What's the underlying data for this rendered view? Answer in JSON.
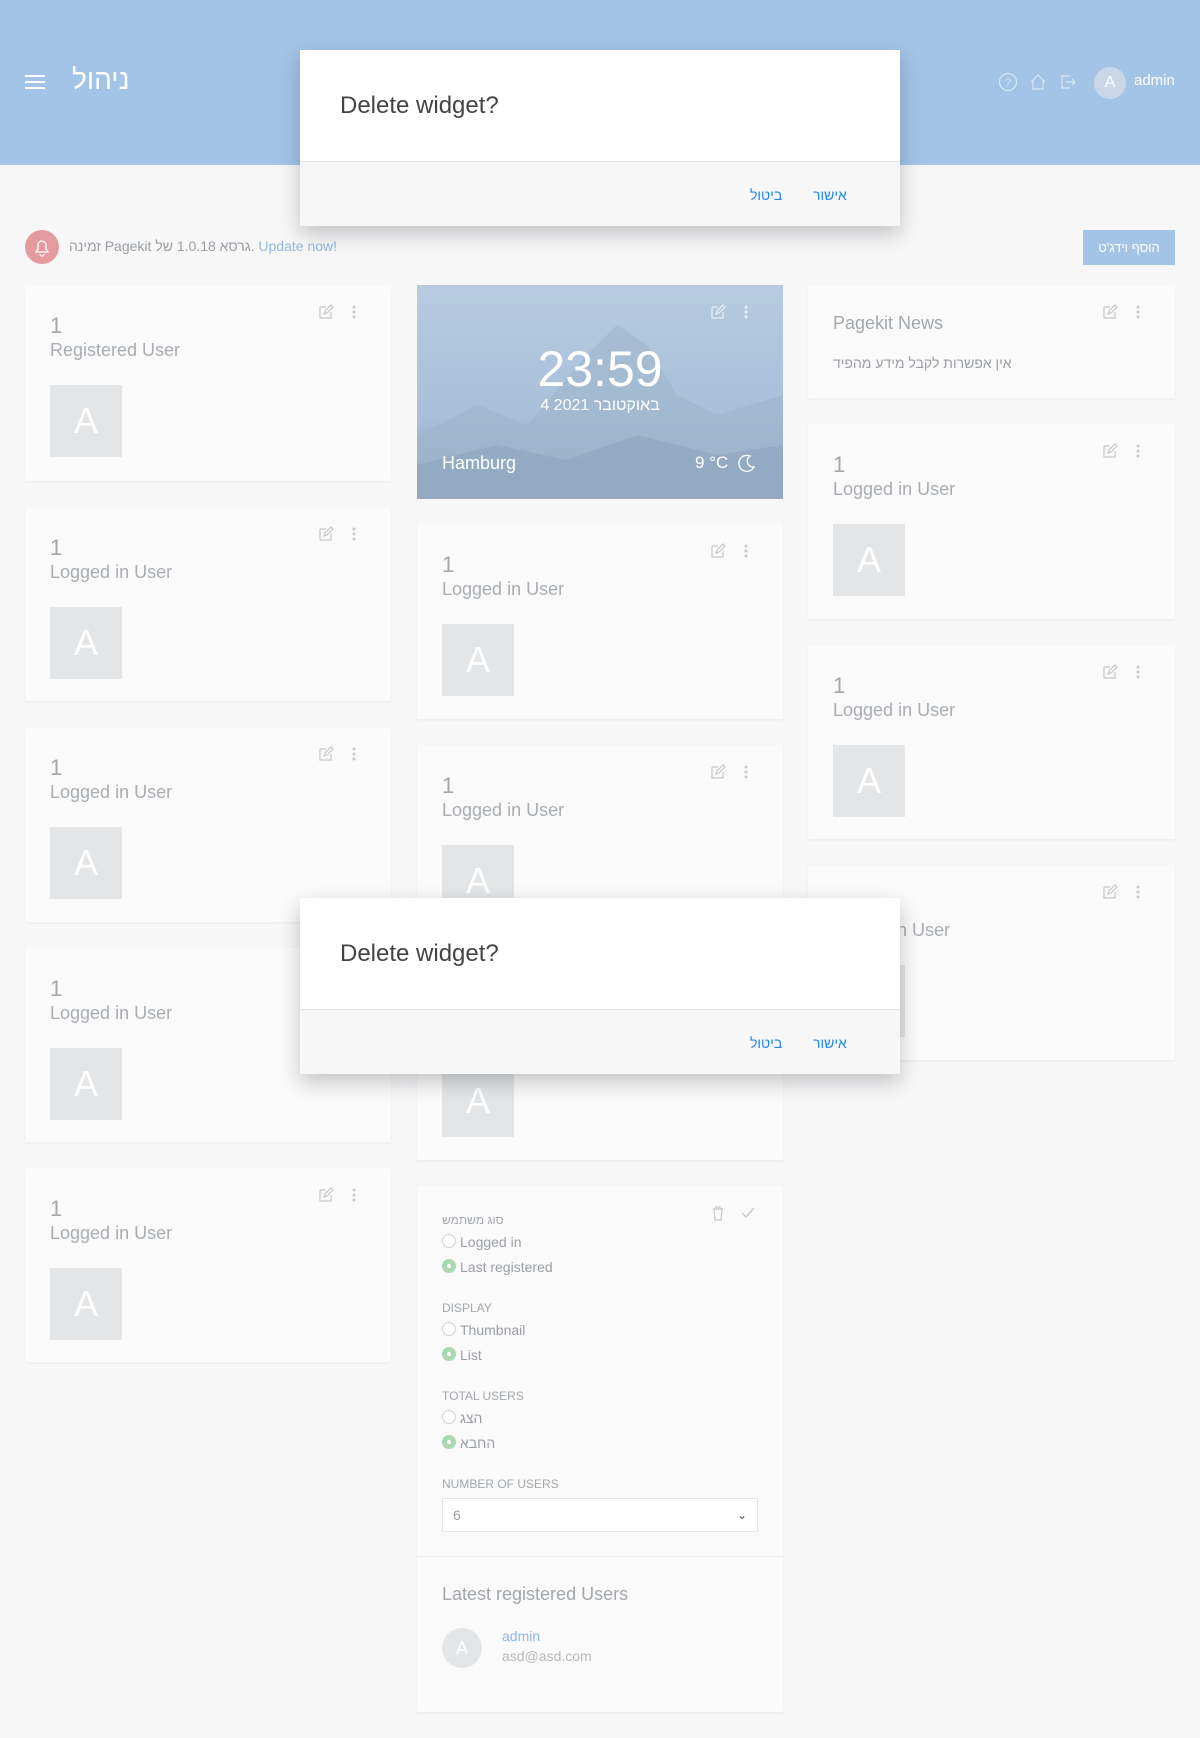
{
  "header": {
    "brand": "ניהול",
    "avatar_initial": "A",
    "username": "admin"
  },
  "notice": {
    "text": "זמינה Pagekit גרסא 1.0.18 של.",
    "link": "Update now!"
  },
  "add_widget_label": "הוסף וידג'ט",
  "widgets_left": [
    {
      "count": "1",
      "label": "Registered User",
      "avatar": "A"
    },
    {
      "count": "1",
      "label": "Logged in User",
      "avatar": "A"
    },
    {
      "count": "1",
      "label": "Logged in User",
      "avatar": "A"
    },
    {
      "count": "1",
      "label": "Logged in User",
      "avatar": "A"
    },
    {
      "count": "1",
      "label": "Logged in User",
      "avatar": "A"
    }
  ],
  "weather": {
    "time": "23:59",
    "date": "4 2021 באוקטובר",
    "city": "Hamburg",
    "temp": "9 °C"
  },
  "widgets_mid": [
    {
      "count": "1",
      "label": "Logged in User",
      "avatar": "A"
    },
    {
      "count": "1",
      "label": "Logged in User",
      "avatar": "A"
    }
  ],
  "mid_bottom_avatar": "A",
  "news": {
    "title": "Pagekit News",
    "text": "אין אפשרות לקבל מידע מהפיד"
  },
  "widgets_right": [
    {
      "count": "1",
      "label": "Logged in User",
      "avatar": "A"
    },
    {
      "count": "1",
      "label": "Logged in User",
      "avatar": "A"
    }
  ],
  "right_partial_label": "in User",
  "settings": {
    "user_type_label": "סוג משתמש",
    "user_type_options": [
      "Logged in",
      "Last registered"
    ],
    "display_label": "DISPLAY",
    "display_options": [
      "Thumbnail",
      "List"
    ],
    "total_label": "TOTAL USERS",
    "total_options": [
      "הצג",
      "החבא"
    ],
    "number_label": "NUMBER OF USERS",
    "number_value": "6",
    "latest_title": "Latest registered Users",
    "latest_user": {
      "avatar": "A",
      "name": "admin",
      "email": "asd@asd.com"
    }
  },
  "modal": {
    "title": "Delete widget?",
    "ok": "אישור",
    "cancel": "ביטול"
  }
}
